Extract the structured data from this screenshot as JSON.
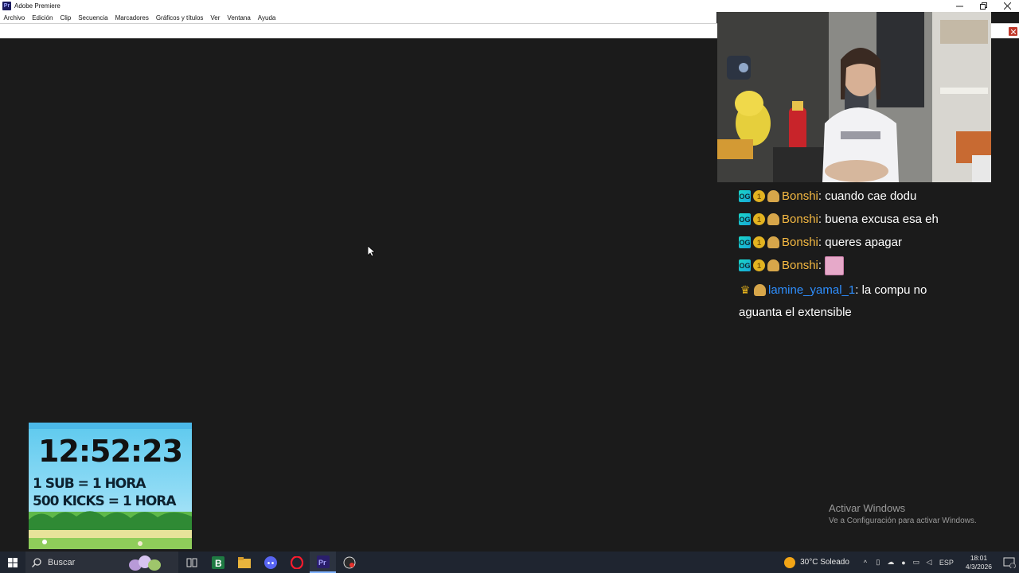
{
  "window": {
    "title": "Adobe Premiere",
    "app_icon": "Pr"
  },
  "menu": [
    "Archivo",
    "Edición",
    "Clip",
    "Secuencia",
    "Marcadores",
    "Gráficos y títulos",
    "Ver",
    "Ventana",
    "Ayuda"
  ],
  "chat": {
    "messages": [
      {
        "user": "Bonshi",
        "text": "cuando cae dodu",
        "badges": [
          "og-icon",
          "coin-icon",
          "taco-icon"
        ]
      },
      {
        "user": "Bonshi",
        "text": "buena excusa esa eh",
        "badges": [
          "og-icon",
          "coin-icon",
          "taco-icon"
        ]
      },
      {
        "user": "Bonshi",
        "text": "queres apagar",
        "badges": [
          "og-icon",
          "coin-icon",
          "taco-icon"
        ]
      },
      {
        "user": "Bonshi",
        "text": "",
        "emote": "emote-image",
        "badges": [
          "og-icon",
          "coin-icon",
          "taco-icon"
        ]
      },
      {
        "user": "lamine_yamal_1",
        "text": "la compu no",
        "text_line2": "aguanta el extensible",
        "badges": [
          "crown-icon",
          "taco-icon"
        ]
      }
    ],
    "colors": {
      "user_primary": "#f5b942",
      "user_secondary": "#2e8fff"
    }
  },
  "timer": {
    "time": "12:52:23",
    "line1": "1 SUB = 1 HORA",
    "line2": "500 KICKS = 1 HORA"
  },
  "watermark": {
    "title": "Activar Windows",
    "subtitle": "Ve a Configuración para activar Windows."
  },
  "taskbar": {
    "search_placeholder": "Buscar",
    "weather": "30°C  Soleado",
    "language": "ESP",
    "time": "18:01",
    "date": "4/3/2026",
    "notifications": "5"
  }
}
